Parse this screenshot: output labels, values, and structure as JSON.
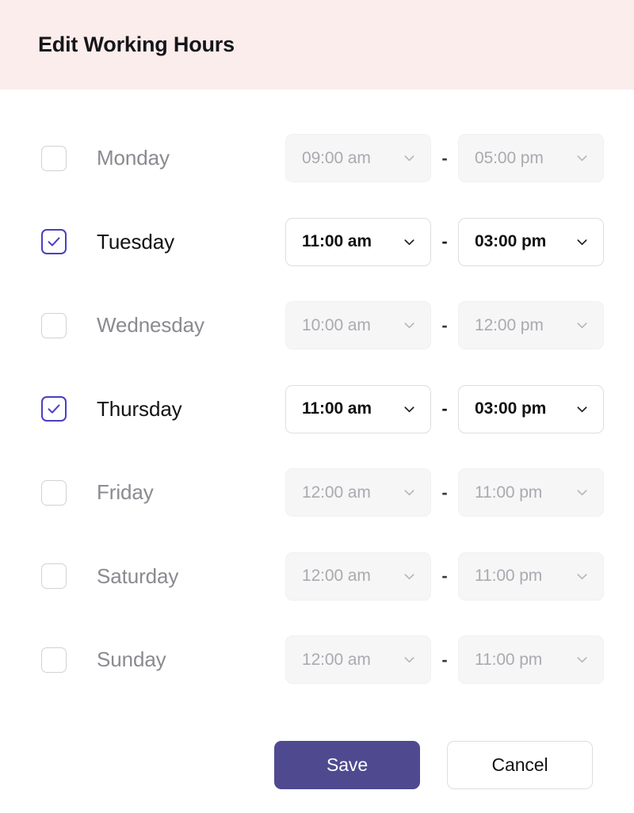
{
  "header": {
    "title": "Edit Working Hours"
  },
  "colors": {
    "header_background": "#fceded",
    "accent_purple": "#4a3fc0",
    "save_button": "#4f4a90",
    "disabled_field": "#f6f6f7",
    "disabled_text": "#aaaab0",
    "border": "#dedee3"
  },
  "separator": "-",
  "icons": {
    "chevron": "chevron-down-icon",
    "check": "check-icon"
  },
  "days": [
    {
      "label": "Monday",
      "checked": false,
      "start_time": "09:00 am",
      "end_time": "05:00 pm"
    },
    {
      "label": "Tuesday",
      "checked": true,
      "start_time": "11:00 am",
      "end_time": "03:00 pm"
    },
    {
      "label": "Wednesday",
      "checked": false,
      "start_time": "10:00 am",
      "end_time": "12:00 pm"
    },
    {
      "label": "Thursday",
      "checked": true,
      "start_time": "11:00 am",
      "end_time": "03:00 pm"
    },
    {
      "label": "Friday",
      "checked": false,
      "start_time": "12:00 am",
      "end_time": "11:00 pm"
    },
    {
      "label": "Saturday",
      "checked": false,
      "start_time": "12:00 am",
      "end_time": "11:00 pm"
    },
    {
      "label": "Sunday",
      "checked": false,
      "start_time": "12:00 am",
      "end_time": "11:00 pm"
    }
  ],
  "footer": {
    "save_label": "Save",
    "cancel_label": "Cancel"
  }
}
